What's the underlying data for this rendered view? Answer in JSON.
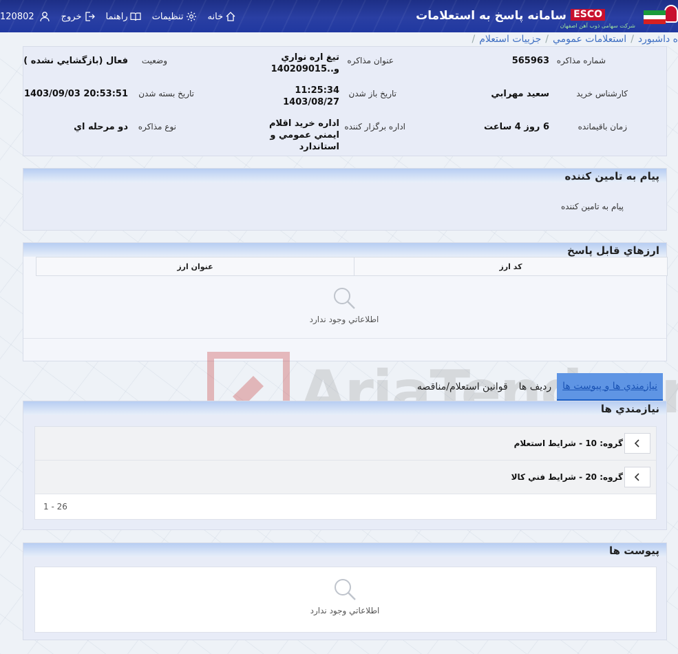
{
  "header": {
    "app_title": "سامانه پاسخ به استعلامات",
    "esco_label": "ESCO",
    "esco_sub": "شرکت سهامی ذوب آهن اصفهان",
    "toolbar": {
      "home": "خانه",
      "settings": "تنظیمات",
      "help": "راهنما",
      "logout": "خروج",
      "user_id": "120802"
    }
  },
  "breadcrumb": [
    "ه داشبورد",
    "استعلامات عمومي",
    "جزييات استعلام"
  ],
  "info": {
    "number_label": "شماره مذاكره",
    "number_value": "565963",
    "subject_label": "عنوان مذاكره",
    "subject_value": "تيغ اره نواري و..140209015",
    "status_label": "وضعيت",
    "status_value": "فعال (بازگشايي نشده )",
    "expert_label": "كارشناس خريد",
    "expert_value": "سعيد مهرابي",
    "open_label": "تاريخ باز شدن",
    "open_value_time": "11:25:34",
    "open_value_date": "1403/08/27",
    "close_label": "تاريخ بسته شدن",
    "close_value": "1403/09/03 20:53:51",
    "remaining_label": "زمان باقيمانده",
    "remaining_value": "6 روز 4 ساعت",
    "dept_label": "اداره برگزار كننده",
    "dept_value": "اداره خريد اقلام ايمني عمومي و استاندارد",
    "type_label": "نوع مذاكره",
    "type_value": "دو مرحله اي"
  },
  "message": {
    "title": "پيام به تامين كننده",
    "body": "پيام به تامين كننده"
  },
  "currencies": {
    "title": "ارزهاي قابل پاسخ",
    "col_code": "كد ارز",
    "col_title": "عنوان ارز",
    "empty": "اطلاعاتي وجود ندارد"
  },
  "tabs": [
    "نيازمندي ها و پيوست ها",
    "رديف ها",
    "قوانين استعلام/مناقصه"
  ],
  "needs": {
    "title": "نيازمندي ها",
    "groups": [
      {
        "label": "گروه: 10 - شرايط استعلام"
      },
      {
        "label": "گروه: 20 - شرايط فني كالا"
      }
    ],
    "pager": "1 - 26"
  },
  "attachments": {
    "title": "پيوست ها",
    "empty": "اطلاعاتي وجود ندارد"
  },
  "watermark": "AriaTender.neT",
  "colors": {
    "header_blue": "#2038a0",
    "panel_head": "#b7cdf2",
    "tab_active": "#5f95e4",
    "link": "#3f6fc2"
  }
}
